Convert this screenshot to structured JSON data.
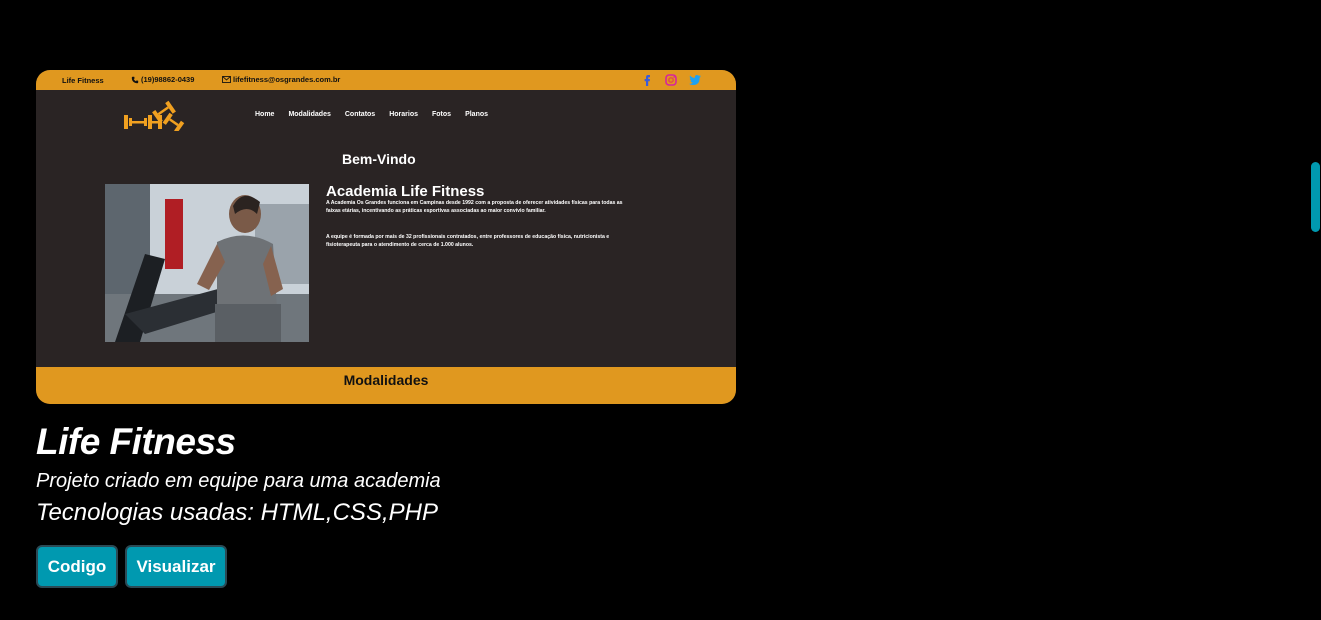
{
  "preview": {
    "topbar": {
      "site_name": "Life Fitness",
      "phone": "(19)98862-0439",
      "email": "lifefitness@osgrandes.com.br",
      "social": [
        "facebook-icon",
        "instagram-icon",
        "twitter-icon"
      ]
    },
    "nav": [
      "Home",
      "Modalidades",
      "Contatos",
      "Horarios",
      "Fotos",
      "Planos"
    ],
    "welcome": "Bem-Vindo",
    "about_title": "Academia Life Fitness",
    "about_p1": "A Academia Os Grandes funciona em Campinas desde 1992 com a proposta de oferecer atividades físicas para todas as faixas etárias, incentivando as práticas esportivas associadas ao maior convívio familiar.",
    "about_p2": "A equipe é formada por mais de 32 profissionais contratados, entre professores de educação física, nutricionista e fisioterapeuta para o atendimento de cerca de 1.000 alunos.",
    "section_title": "Modalidades"
  },
  "project": {
    "title": "Life Fitness",
    "description": "Projeto criado em equipe para uma academia",
    "technologies": "Tecnologias usadas: HTML,CSS,PHP"
  },
  "buttons": {
    "code": "Codigo",
    "view": "Visualizar"
  },
  "colors": {
    "accent": "#e0981f",
    "button": "#0099b0",
    "site_bg": "#2a2424",
    "page_bg": "#000000"
  }
}
